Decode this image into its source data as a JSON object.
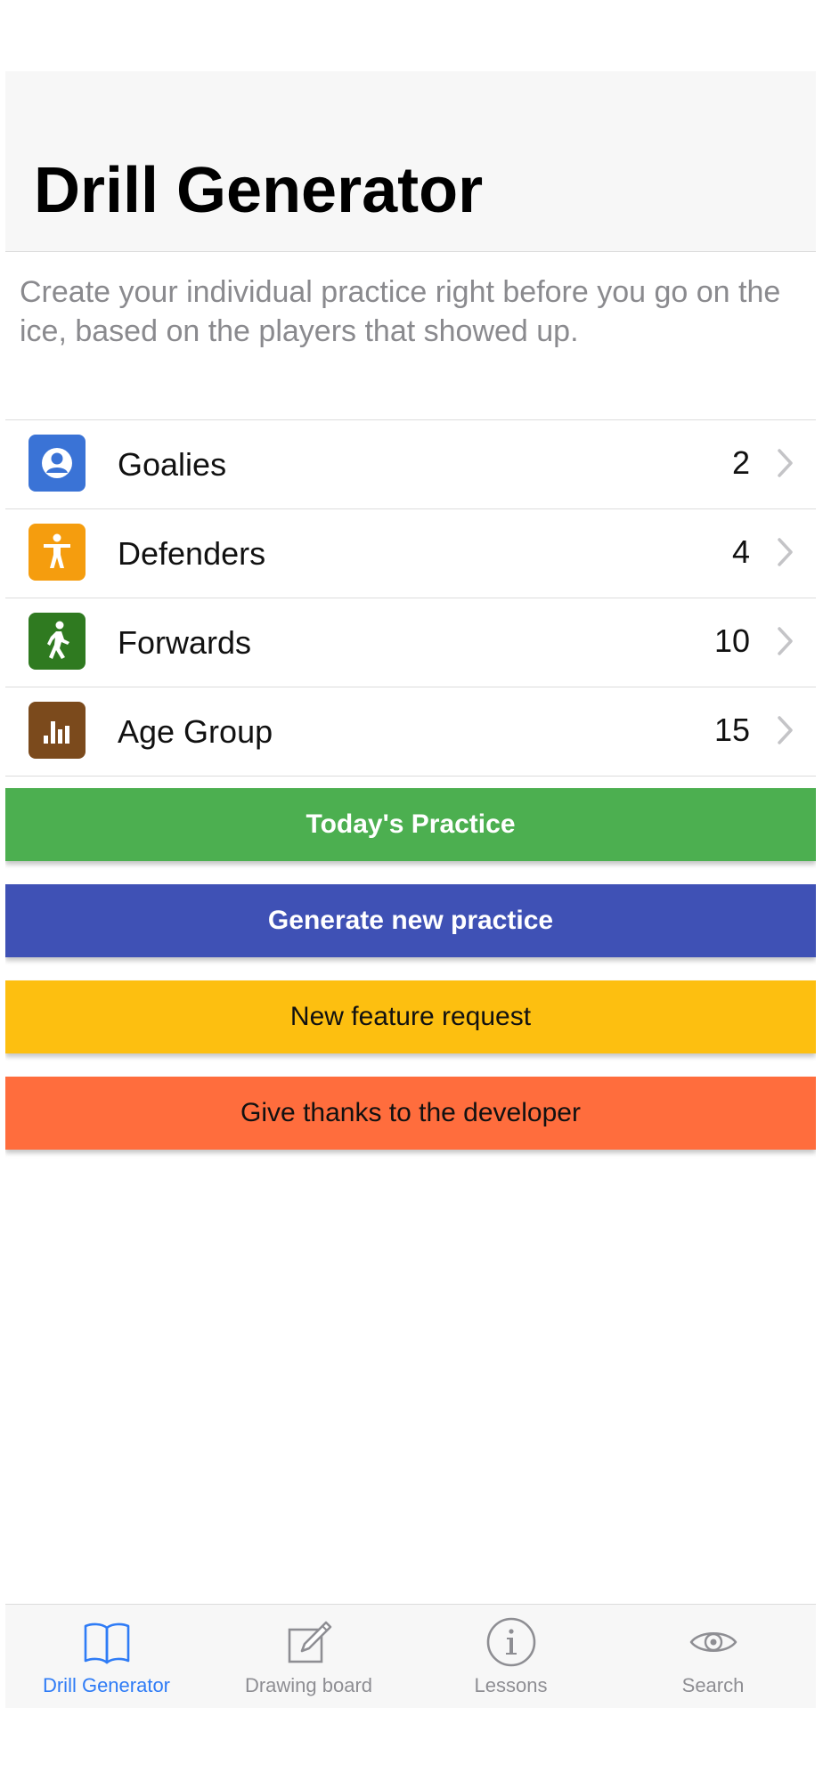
{
  "header": {
    "title": "Drill Generator"
  },
  "description": "Create your individual practice right before you go on the ice, based on the players that showed up.",
  "list": [
    {
      "label": "Goalies",
      "value": "2",
      "icon": "person-circle-icon",
      "color": "#3a73d6"
    },
    {
      "label": "Defenders",
      "value": "4",
      "icon": "accessibility-icon",
      "color": "#f59d0e"
    },
    {
      "label": "Forwards",
      "value": "10",
      "icon": "walking-person-icon",
      "color": "#2f7a20"
    },
    {
      "label": "Age Group",
      "value": "15",
      "icon": "bar-chart-icon",
      "color": "#7b4a1c"
    }
  ],
  "buttons": {
    "today": "Today's Practice",
    "generate": "Generate new practice",
    "feature": "New feature request",
    "thanks": "Give thanks to the developer"
  },
  "button_colors": {
    "today": "#4caf50",
    "generate": "#3f51b5",
    "feature": "#fdbf10",
    "thanks": "#ff6d3d"
  },
  "tabs": [
    {
      "label": "Drill Generator",
      "icon": "book-icon",
      "active": true
    },
    {
      "label": "Drawing board",
      "icon": "compose-icon",
      "active": false
    },
    {
      "label": "Lessons",
      "icon": "info-icon",
      "active": false
    },
    {
      "label": "Search",
      "icon": "eye-icon",
      "active": false
    }
  ],
  "colors": {
    "accent": "#2f7cf6",
    "inactive_tab": "#8e8e93",
    "secondary_text": "#8a8a8e"
  }
}
